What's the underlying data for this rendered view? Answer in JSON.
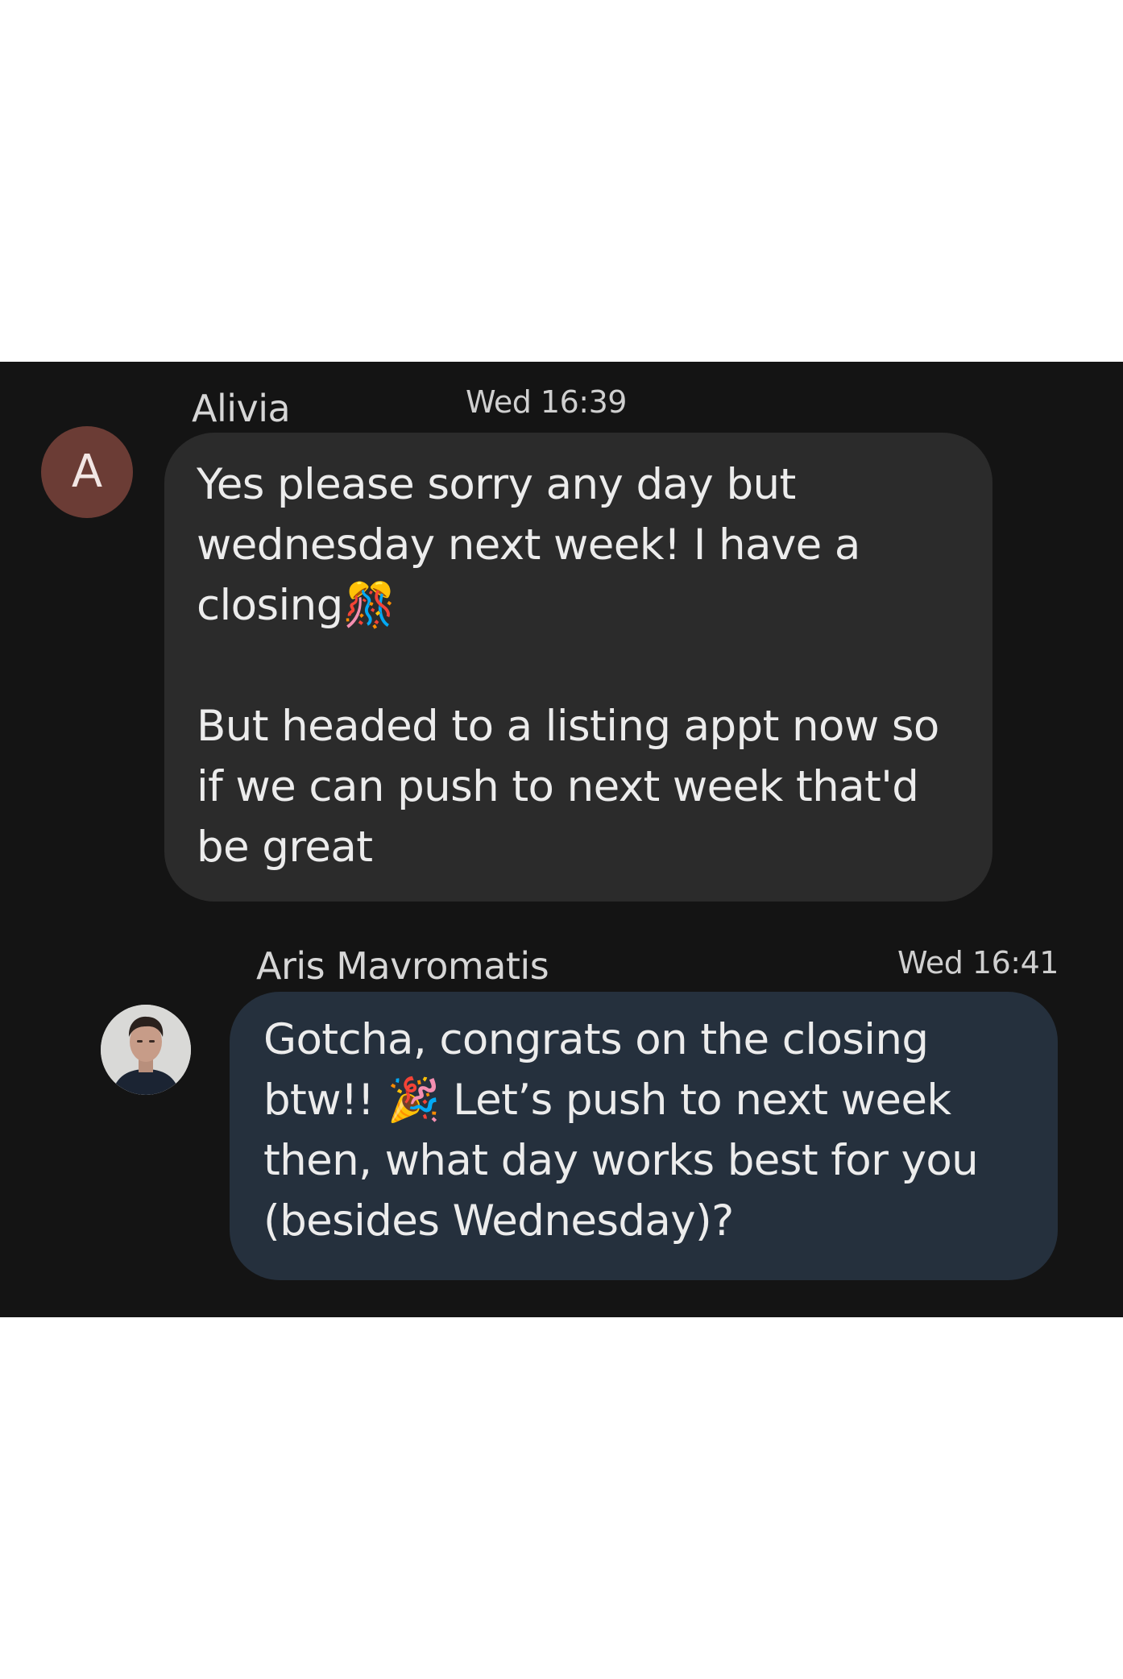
{
  "messages": [
    {
      "sender": "Alivia",
      "time": "Wed 16:39",
      "avatar_initial": "A",
      "text": "Yes please sorry any day but wednesday next week! I have a closing🎊\n\nBut headed to a listing appt now so if we can push to next week that'd be great"
    },
    {
      "sender": "Aris Mavromatis",
      "time": "Wed 16:41",
      "avatar_icon": "profile-photo",
      "text": "Gotcha, congrats on the closing btw!! 🎉 Let’s push to next week then, what day works best for you (besides Wednesday)?"
    }
  ],
  "colors": {
    "panel_background": "#141414",
    "incoming_bubble": "#2b2b2b",
    "outgoing_bubble": "#25303d",
    "avatar_letter_background": "#6b3c35"
  }
}
